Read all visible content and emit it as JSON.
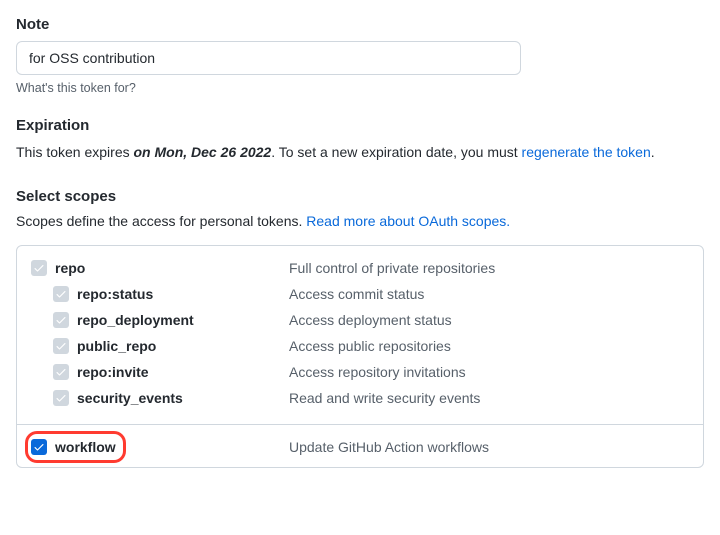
{
  "note": {
    "heading": "Note",
    "value": "for OSS contribution",
    "help": "What's this token for?"
  },
  "expiration": {
    "heading": "Expiration",
    "prefix": "This token expires ",
    "date": "on Mon, Dec 26 2022",
    "middle": ". To set a new expiration date, you must ",
    "regenerate_link": "regenerate the token",
    "suffix": "."
  },
  "scopes": {
    "heading": "Select scopes",
    "intro": "Scopes define the access for personal tokens. ",
    "learn_more": "Read more about OAuth scopes.",
    "repo_group": {
      "parent": {
        "name": "repo",
        "desc": "Full control of private repositories"
      },
      "children": [
        {
          "name": "repo:status",
          "desc": "Access commit status"
        },
        {
          "name": "repo_deployment",
          "desc": "Access deployment status"
        },
        {
          "name": "public_repo",
          "desc": "Access public repositories"
        },
        {
          "name": "repo:invite",
          "desc": "Access repository invitations"
        },
        {
          "name": "security_events",
          "desc": "Read and write security events"
        }
      ]
    },
    "workflow": {
      "name": "workflow",
      "desc": "Update GitHub Action workflows"
    }
  }
}
